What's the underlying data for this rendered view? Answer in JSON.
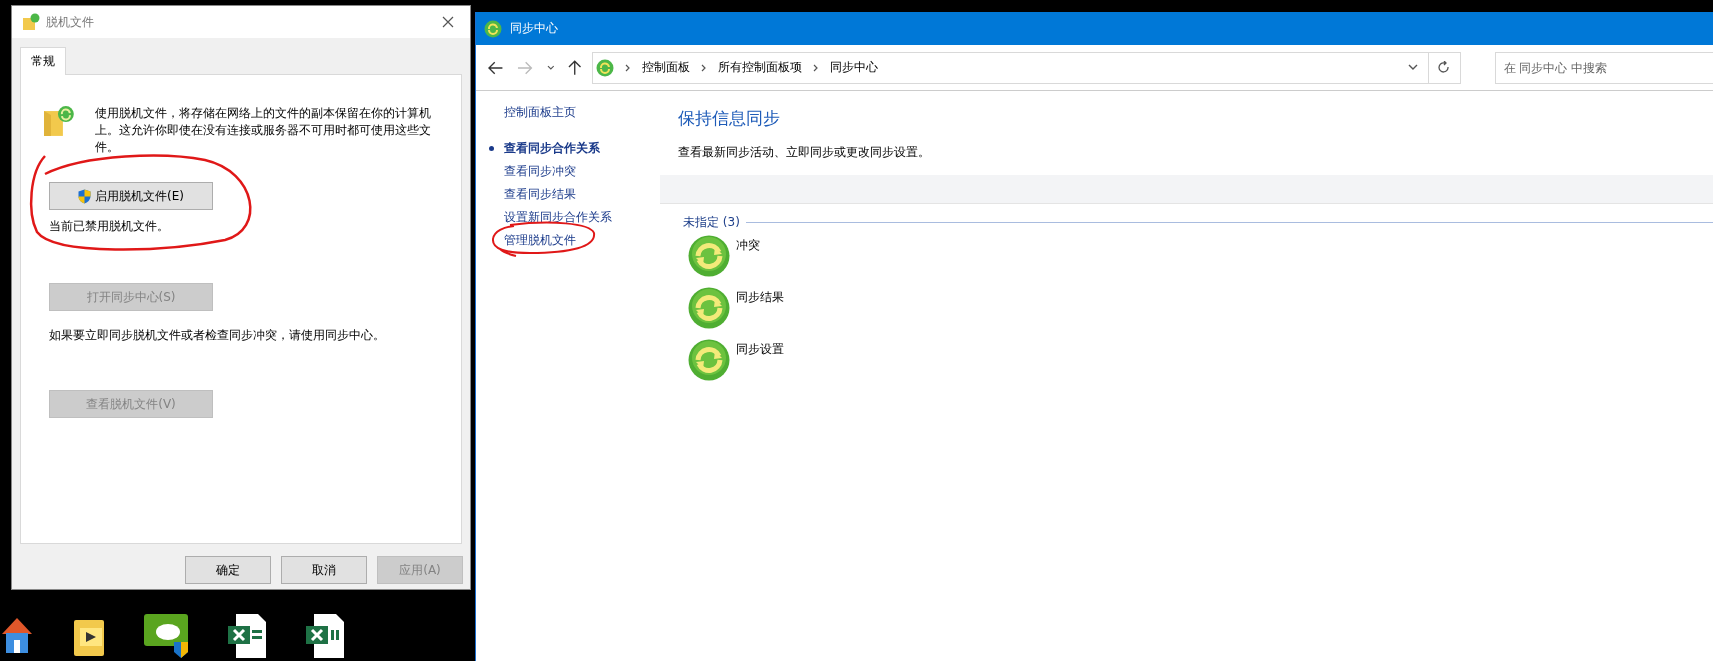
{
  "dialog": {
    "title": "脱机文件",
    "tabs": [
      {
        "label": "常规",
        "selected": true
      }
    ],
    "description": "使用脱机文件，将存储在网络上的文件的副本保留在你的计算机上。这允许你即使在没有连接或服务器不可用时都可使用这些文件。",
    "enable_button": {
      "label": "启用脱机文件(E)",
      "disabled": false,
      "circled": true
    },
    "status": "当前已禁用脱机文件。",
    "sync_center_button": {
      "label": "打开同步中心(S)",
      "disabled": true
    },
    "sync_hint": "如果要立即同步脱机文件或者检查同步冲突，请使用同步中心。",
    "view_button": {
      "label": "查看脱机文件(V)",
      "disabled": true
    },
    "footer_buttons": [
      {
        "label": "确定",
        "disabled": false
      },
      {
        "label": "取消",
        "disabled": false
      },
      {
        "label": "应用(A)",
        "disabled": true
      }
    ]
  },
  "sync_window": {
    "title": "同步中心",
    "breadcrumb": [
      "控制面板",
      "所有控制面板项",
      "同步中心"
    ],
    "search": {
      "placeholder": "在 同步中心 中搜索"
    },
    "sidebar": {
      "home": "控制面板主页",
      "items": [
        {
          "label": "查看同步合作关系",
          "selected": true,
          "circled": false
        },
        {
          "label": "查看同步冲突",
          "selected": false,
          "circled": false
        },
        {
          "label": "查看同步结果",
          "selected": false,
          "circled": false
        },
        {
          "label": "设置新同步合作关系",
          "selected": false,
          "circled": false
        },
        {
          "label": "管理脱机文件",
          "selected": false,
          "circled": true
        }
      ]
    },
    "heading": "保持信息同步",
    "subtitle": "查看最新同步活动、立即同步或更改同步设置。",
    "group": {
      "label": "未指定 (3)",
      "items": [
        "冲突",
        "同步结果",
        "同步设置"
      ]
    }
  }
}
